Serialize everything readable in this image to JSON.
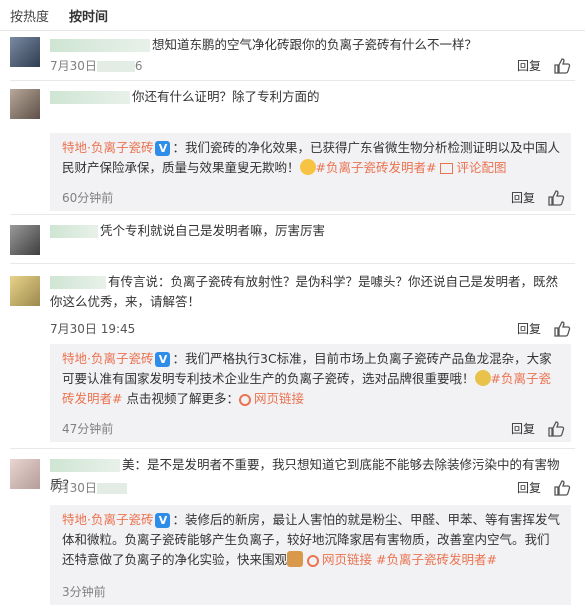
{
  "tabs": [
    "按热度",
    "按时间"
  ],
  "actions": {
    "reply": "回复"
  },
  "colors": {
    "accent": "#eb7350",
    "verified": "#2e8de8",
    "reply_bg": "#f2f2f5"
  },
  "c1": {
    "text": "想知道东鹏的空气净化砖跟你的负离子瓷砖有什么不一样？",
    "time": "7月30日",
    "time_tail": "6"
  },
  "c2": {
    "text": "你还有什么证明？除了专利方面的",
    "reply": {
      "author": "特地·负离子瓷砖",
      "badge": "V",
      "text": "：我们瓷砖的净化效果，已获得广东省微生物分析检测证明以及中国人民财产保险承保，质量与效果童叟无欺哟！",
      "tag": "#负离子瓷砖发明者#",
      "extra": "评论配图",
      "time": "60分钟前"
    }
  },
  "c3": {
    "text": "凭个专利就说自己是发明者嘛，厉害厉害"
  },
  "c4": {
    "text": "有传言说：负离子瓷砖有放射性？是伪科学？是噱头？你还说自己是发明者，既然你这么优秀，来，请解答！",
    "time": "7月30日 19:45",
    "reply": {
      "author": "特地·负离子瓷砖",
      "badge": "V",
      "text": "：我们严格执行3C标准，目前市场上负离子瓷砖产品鱼龙混杂，大家可要认准有国家发明专利技术企业生产的负离子瓷砖，选对品牌很重要哦！",
      "tag": "#负离子瓷砖发明者#",
      "text2": " 点击视频了解更多：",
      "link": "网页链接",
      "time": "47分钟前"
    }
  },
  "c5": {
    "name_tail": "美",
    "text": "：是不是发明者不重要，我只想知道它到底能不能够去除装修污染中的有害物质？",
    "time": "7月30日",
    "reply": {
      "author": "特地·负离子瓷砖",
      "badge": "V",
      "text": "：装修后的新房，最让人害怕的就是粉尘、甲醛、甲苯、等有害挥发气体和微粒。负离子瓷砖能够产生负离子，较好地沉降家居有害物质，改善室内空气。我们还特意做了负离子的净化实验，快来围观",
      "link": "网页链接",
      "tag": "#负离子瓷砖发明者#",
      "time": "3分钟前"
    }
  }
}
